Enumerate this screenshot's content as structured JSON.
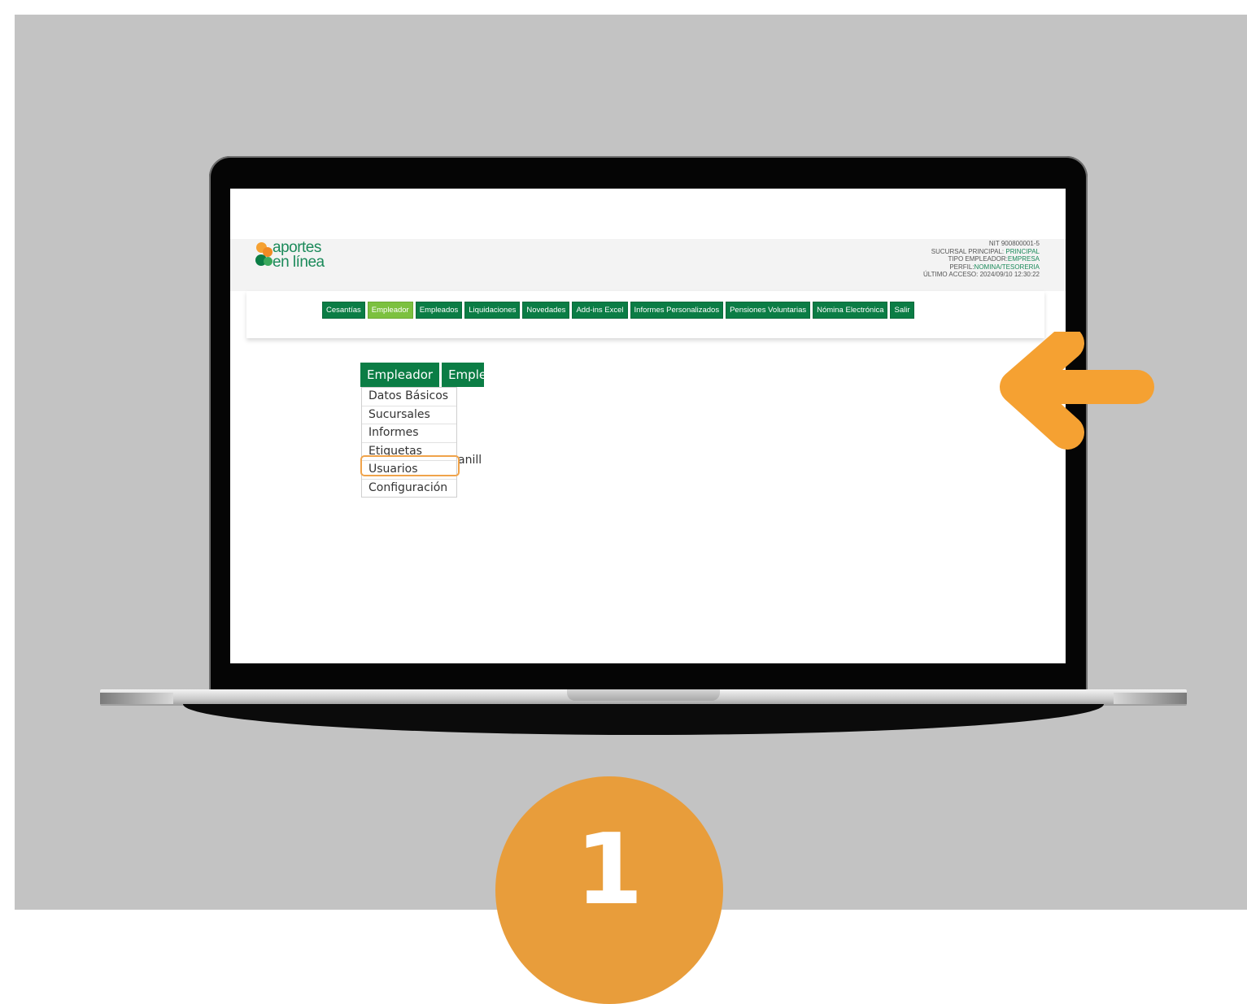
{
  "brand": {
    "line1": "aportes",
    "line2": "en línea"
  },
  "account": {
    "nit": "NIT 900800001-5",
    "sucursal_label": "SUCURSAL PRINCIPAL: ",
    "sucursal_value": "PRINCIPAL",
    "tipo_label": "TIPO EMPLEADOR:",
    "tipo_value": "EMPRESA",
    "perfil_label": "PERFIL:",
    "perfil_value": "NOMINA/TESORERIA",
    "ultimo_acceso": "ÚLTIMO ACCESO: 2024/09/10 12:30:22"
  },
  "nav": {
    "items": [
      {
        "label": "Cesantías"
      },
      {
        "label": "Empleador",
        "active": true
      },
      {
        "label": "Empleados"
      },
      {
        "label": "Liquidaciones"
      },
      {
        "label": "Novedades"
      },
      {
        "label": "Add-ins Excel"
      },
      {
        "label": "Informes Personalizados"
      },
      {
        "label": "Pensiones Voluntarias"
      },
      {
        "label": "Nómina Electrónica"
      },
      {
        "label": "Salir"
      }
    ]
  },
  "submenu": {
    "button1": "Empleador",
    "button2": "Emplead",
    "items": [
      {
        "label": "Datos Básicos"
      },
      {
        "label": "Sucursales"
      },
      {
        "label": "Informes"
      },
      {
        "label": "Etiquetas"
      },
      {
        "label": "Usuarios",
        "highlighted": true
      },
      {
        "label": "Configuración"
      }
    ],
    "behind_text": "anill"
  },
  "step": {
    "number": "1"
  },
  "colors": {
    "green": "#0b7d45",
    "active_green": "#7cc13f",
    "orange": "#f5a132",
    "step_orange": "#e89d3b",
    "background": "#c3c3c3"
  },
  "icons": [
    "arrow-left-icon",
    "logo-circles-icon"
  ]
}
